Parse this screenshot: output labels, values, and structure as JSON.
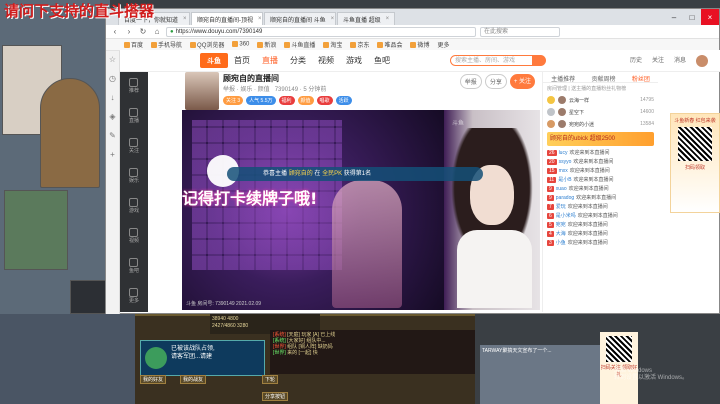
{
  "overlay_title": "请问下支持的直斗搭器",
  "browser": {
    "tabs": [
      {
        "label": "百度一下，你就知道"
      },
      {
        "label": "顺宛自的直播间-顶视"
      },
      {
        "label": "顺宛自的直播间 斗鱼"
      },
      {
        "label": "斗鱼直播 超级"
      },
      {
        "label": "斗鱼直播-游戏直播"
      }
    ],
    "url": "https://www.douyu.com/7390149",
    "search_placeholder": "在此搜索",
    "bookmarks": [
      "百度",
      "手机导航",
      "QQ浏览器",
      "360",
      "新浪",
      "斗鱼直播",
      "淘宝",
      "京东",
      "唯品会",
      "微博",
      "更多"
    ]
  },
  "douyu": {
    "logo": "斗鱼",
    "nav": [
      "首页",
      "直播",
      "分类",
      "视频",
      "游戏",
      "鱼吧"
    ],
    "search_placeholder": "搜索主播、房间、游戏",
    "header_right": [
      "历史",
      "关注",
      "消息"
    ],
    "side": [
      "推荐",
      "直播",
      "关注",
      "娱乐",
      "游戏",
      "视频",
      "鱼吧",
      "更多"
    ],
    "room_title": "顾宛自的直播间",
    "room_meta": "举报 · 娱乐 · 颜值",
    "room_meta2": "7390149  ·  5 分钟前",
    "tags": [
      "关注 3",
      "人气 5.5万",
      "福利",
      "颜值",
      "唱歌",
      "活跃",
      "粉丝 3"
    ],
    "btn_follow": "+ 关注",
    "btn_share": "分享",
    "btn_report": "举报",
    "video_banner_prefix": "恭喜主播",
    "video_banner_hl": "顾宛自的",
    "video_banner_mid": "在",
    "video_banner_hl2": "全民PK",
    "video_banner_suffix": "获得第1名",
    "video_big_text": "记得打卡续牌子哦!",
    "video_mark": "斗鱼",
    "video_footer": "斗鱼 房间号: 7390149  2021.02.09",
    "rp_tabs": [
      "主播推荐",
      "贡献周榜",
      "粉丝团"
    ],
    "rp_sub": "房间管理 | 送主播的直播粉丝礼物榜",
    "rank": [
      {
        "name": "云海一样",
        "score": "14795"
      },
      {
        "name": "星空下",
        "score": "14600"
      },
      {
        "name": "宛宛的小迷",
        "score": "13584"
      }
    ],
    "gift_banner": "顾宛自的ubick  超级2500",
    "chat": [
      {
        "lv": "26",
        "name": "lucy",
        "msg": "欢迎来到本直播间"
      },
      {
        "lv": "20",
        "name": "ssyyo",
        "msg": "欢迎来到本直播间"
      },
      {
        "lv": "15",
        "name": "mxx",
        "msg": "欢迎来到本直播间"
      },
      {
        "lv": "11",
        "name": "是小B",
        "msg": "欢迎来到本直播间"
      },
      {
        "lv": "9",
        "name": "xuao",
        "msg": "欢迎来到本直播间"
      },
      {
        "lv": "9",
        "name": "paradog",
        "msg": "欢迎来到本直播间"
      },
      {
        "lv": "7",
        "name": "爱玩",
        "msg": "欢迎来到本直播间"
      },
      {
        "lv": "6",
        "name": "是小米吗",
        "msg": "欢迎来到本直播间"
      },
      {
        "lv": "5",
        "name": "宛宛",
        "msg": "欢迎来到本直播间"
      },
      {
        "lv": "4",
        "name": "大海",
        "msg": "欢迎来到本直播间"
      },
      {
        "lv": "3",
        "name": "小鱼",
        "msg": "欢迎来到本直播间"
      }
    ],
    "ad_text": "斗鱼新春 红包来袭",
    "ad_sub": "扫码领取"
  },
  "game": {
    "stats": {
      "row1": "38940    4800",
      "row2": "2427/4860  3280"
    },
    "chat": [
      {
        "t": "[系统]",
        "c": "red",
        "m": "[天庭] 玩家 [A] 已上线"
      },
      {
        "t": "[系统]",
        "c": "grn",
        "m": "[大家好] 组队中..."
      },
      {
        "t": "[世界]",
        "c": "red",
        "m": "组队 [铜人阵] 缺奶妈"
      },
      {
        "t": "[世界]",
        "c": "grn",
        "m": "来的 [一起] 快"
      }
    ],
    "popup_line1": "已被该战队占领,",
    "popup_line2": "请客军团...请建",
    "btn1": "我的好友",
    "btn2": "我的战友",
    "btn3": "下轮",
    "btn4": "分享按钮",
    "tarway_text": "TARWAY聚搞天文宣布了一个...",
    "promo_text": "扫码关注 领取好礼"
  },
  "windows_activation": {
    "line1": "激活 Windows",
    "line2": "转到设置以激活 Windows。"
  }
}
